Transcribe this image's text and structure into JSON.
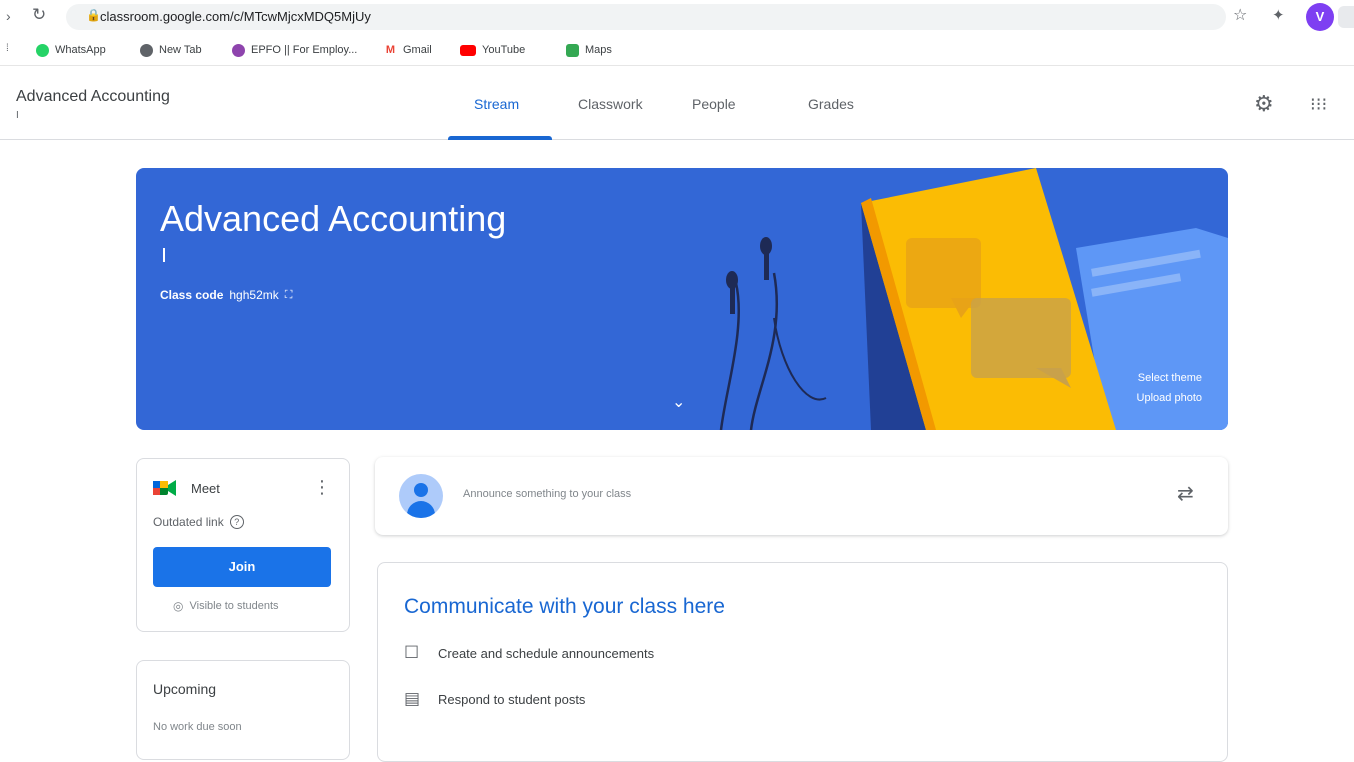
{
  "browser": {
    "url": "classroom.google.com/c/MTcwMjcxMDQ5MjUy",
    "profile_initial": "V",
    "bookmarks": [
      {
        "label": "WhatsApp",
        "color": "#25d366"
      },
      {
        "label": "New Tab",
        "color": "#5f6368"
      },
      {
        "label": "EPFO || For Employ...",
        "color": "#8e44ad"
      },
      {
        "label": "Gmail",
        "color": "#ea4335"
      },
      {
        "label": "YouTube",
        "color": "#ff0000"
      },
      {
        "label": "Maps",
        "color": "#34a853"
      }
    ]
  },
  "header": {
    "class_name": "Advanced Accounting",
    "class_section": "I",
    "tabs": [
      {
        "label": "Stream",
        "active": true
      },
      {
        "label": "Classwork",
        "active": false
      },
      {
        "label": "People",
        "active": false
      },
      {
        "label": "Grades",
        "active": false
      }
    ],
    "icons": [
      "settings-icon",
      "apps-grid-icon"
    ]
  },
  "banner": {
    "title": "Advanced Accounting",
    "class_code_label": "Class code",
    "class_code": "hgh52mk",
    "select_theme": "Select theme",
    "upload_photo": "Upload photo",
    "color": "#3367d6"
  },
  "meet": {
    "label": "Meet",
    "status": "Outdated link",
    "join_label": "Join",
    "visibility": "Visible to students"
  },
  "upcoming": {
    "title": "Upcoming",
    "subtitle": "No work due soon"
  },
  "announce": {
    "placeholder": "Announce something to your class"
  },
  "communicate": {
    "title": "Communicate with your class here",
    "items": [
      {
        "label": "Create and schedule announcements",
        "icon": "announcement-icon"
      },
      {
        "label": "Respond to student posts",
        "icon": "post-icon"
      }
    ]
  },
  "colors": {
    "accent": "#1967d2",
    "button": "#1a73e8"
  }
}
